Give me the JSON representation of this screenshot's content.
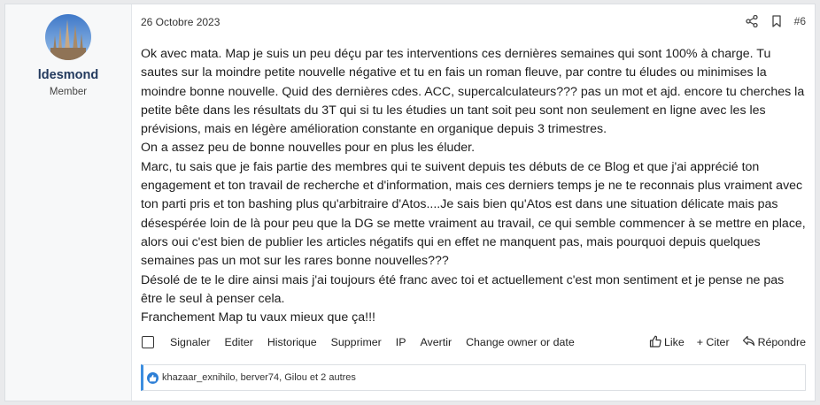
{
  "post": {
    "date": "26 Octobre 2023",
    "number": "#6",
    "paragraphs": [
      "Ok avec mata. Map je suis un peu déçu par tes interventions ces dernières semaines qui sont 100% à charge. Tu sautes sur la moindre petite nouvelle négative et tu en fais un roman fleuve, par contre tu éludes ou minimises la moindre bonne nouvelle. Quid des dernières cdes. ACC, supercalculateurs??? pas un mot et ajd. encore tu cherches la petite bête dans les résultats du 3T qui si tu les étudies un tant soit peu sont non seulement en ligne avec les les prévisions, mais en légère amélioration constante en organique depuis 3 trimestres.",
      "On a assez peu de bonne nouvelles pour en plus les éluder.",
      "Marc, tu sais que je fais partie des membres qui te suivent depuis tes débuts de ce Blog et que j'ai apprécié ton engagement et ton travail de recherche et d'information, mais ces derniers temps je ne te reconnais plus vraiment avec ton parti pris et ton bashing plus qu'arbitraire d'Atos....Je sais bien qu'Atos est dans une situation délicate mais pas désespérée loin de là pour peu que la DG se mette vraiment au travail, ce qui semble commencer à se mettre en place, alors oui c'est bien de publier les articles négatifs qui en effet ne manquent pas, mais pourquoi depuis quelques semaines pas un mot sur les rares bonne nouvelles???",
      "Désolé de te le dire ainsi mais j'ai toujours été franc avec toi et actuellement c'est mon sentiment et je pense ne pas être le seul à penser cela.",
      "Franchement Map tu vaux mieux que ça!!!"
    ]
  },
  "user": {
    "name": "ldesmond",
    "title": "Member"
  },
  "actions": {
    "signaler": "Signaler",
    "editer": "Editer",
    "historique": "Historique",
    "supprimer": "Supprimer",
    "ip": "IP",
    "avertir": "Avertir",
    "change_owner": "Change owner or date",
    "like": "Like",
    "citer": "+ Citer",
    "repondre": "Répondre"
  },
  "reactions": {
    "text": "khazaar_exnihilo, berver74, Gilou et 2 autres"
  },
  "icons": {
    "share": "share-icon",
    "bookmark": "bookmark-icon",
    "like": "thumbs-up-icon",
    "reply": "reply-icon",
    "reaction_badge": "like-badge-icon"
  },
  "colors": {
    "username": "#233a5e",
    "reaction_accent": "#3d8ee0"
  }
}
